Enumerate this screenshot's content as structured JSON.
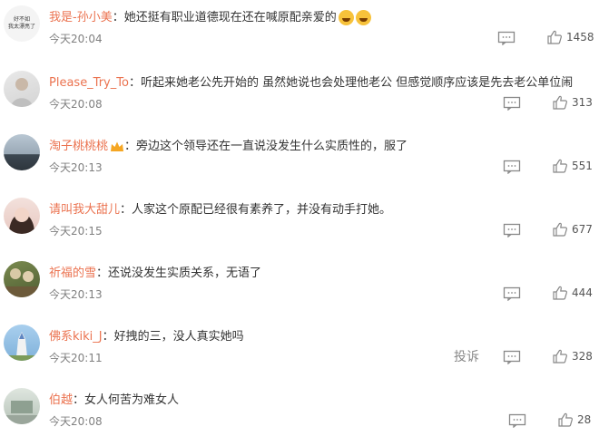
{
  "comments": [
    {
      "avatar_text": "好不如\n我太漂亮了",
      "username": "我是-孙小美",
      "separator": "：",
      "text": "她还挺有职业道德现在还在喊原配亲爱的",
      "emoji": [
        "laughing-crying-emoji",
        "laughing-crying-emoji"
      ],
      "time": "今天20:04",
      "likes": "1458"
    },
    {
      "username": "Please_Try_To",
      "separator": "：",
      "text": "听起来她老公先开始的 虽然她说也会处理他老公 但感觉顺序应该是先去老公单位闹",
      "time": "今天20:08",
      "likes": "313"
    },
    {
      "username": "淘子桃桃桃",
      "separator": "：",
      "text": "旁边这个领导还在一直说没发生什么实质性的，服了",
      "badge": "crown-badge",
      "time": "今天20:13",
      "likes": "551"
    },
    {
      "username": "请叫我大甜儿",
      "separator": "：",
      "text": "人家这个原配已经很有素养了，并没有动手打她。",
      "time": "今天20:15",
      "likes": "677"
    },
    {
      "username": "祈福的雪",
      "separator": "：",
      "text": "还说没发生实质关系，无语了",
      "time": "今天20:13",
      "likes": "444"
    },
    {
      "username": "佛系kiki_J",
      "separator": "：",
      "text": "好拽的三，没人真实她吗",
      "time": "今天20:11",
      "report": "投诉",
      "likes": "328"
    },
    {
      "username": "伯越",
      "separator": "：",
      "text": "女人何苦为难女人",
      "time": "今天20:08",
      "likes": "28"
    }
  ],
  "colors": {
    "username": "#eb7350",
    "text": "#333333",
    "meta": "#808080"
  }
}
